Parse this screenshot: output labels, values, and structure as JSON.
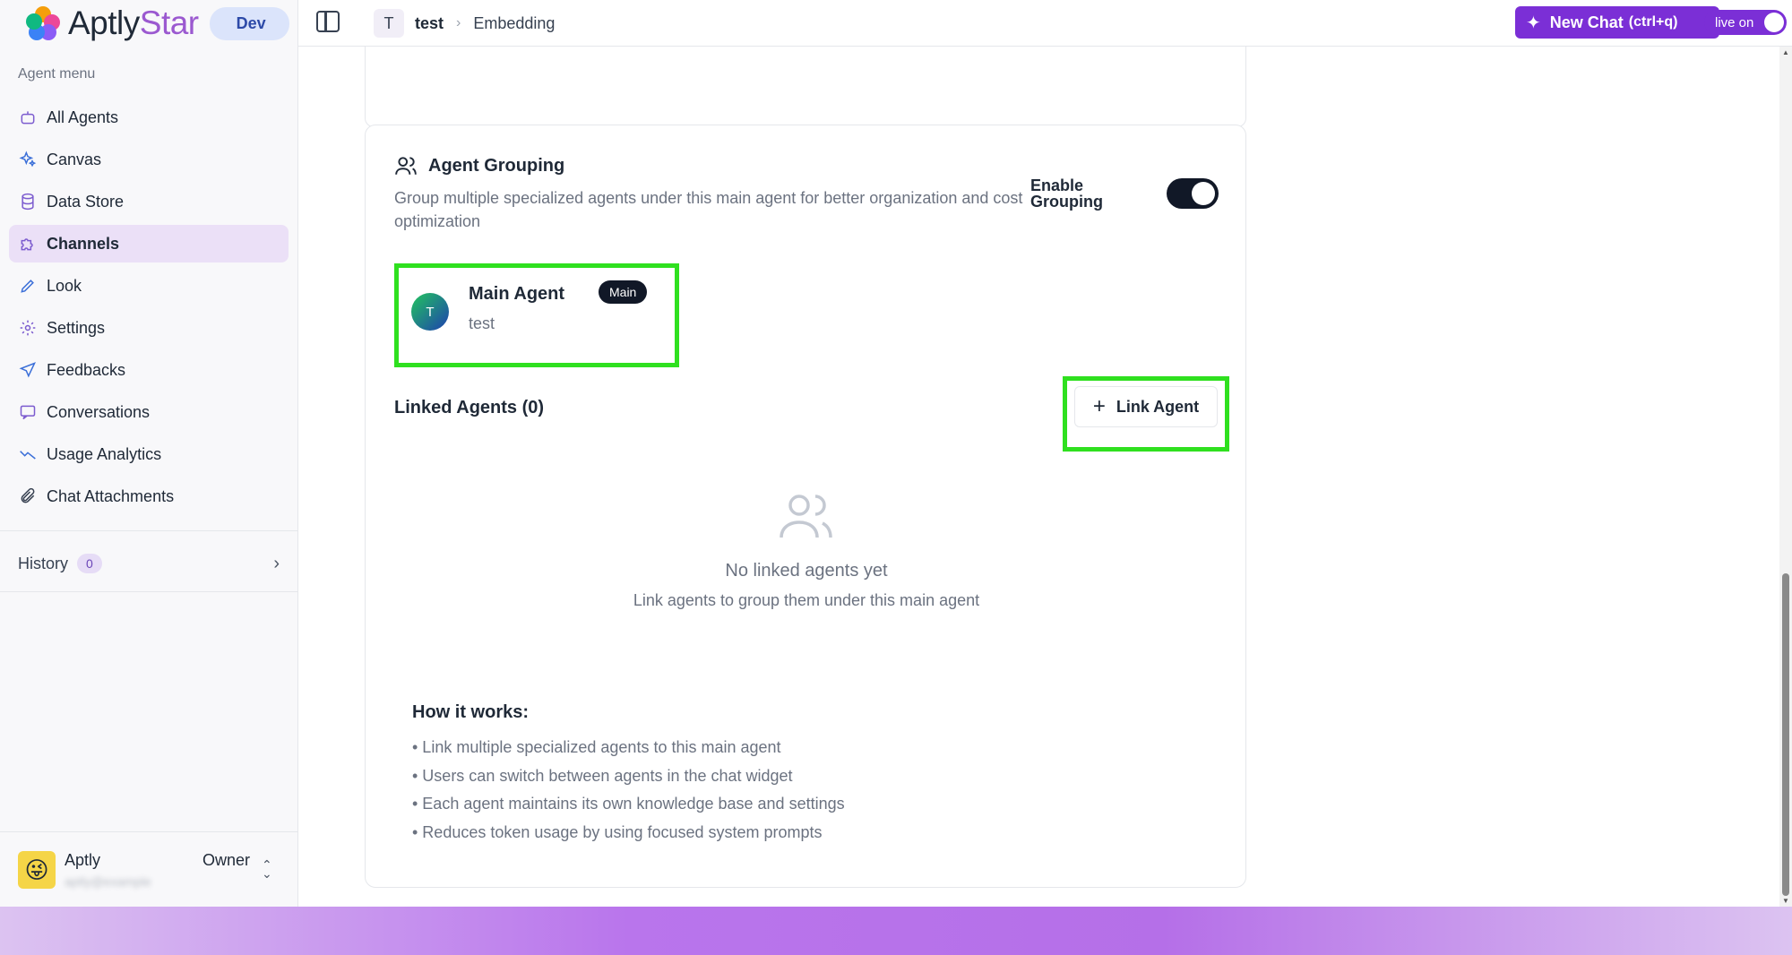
{
  "brand": {
    "name_part1": "Aptly",
    "name_part2": "Star",
    "env_badge": "Dev"
  },
  "sidebar": {
    "heading": "Agent menu",
    "items": [
      {
        "label": "All Agents",
        "icon": "bot-icon",
        "active": false
      },
      {
        "label": "Canvas",
        "icon": "sparkles-icon",
        "active": false
      },
      {
        "label": "Data Store",
        "icon": "database-icon",
        "active": false
      },
      {
        "label": "Channels",
        "icon": "puzzle-icon",
        "active": true
      },
      {
        "label": "Look",
        "icon": "pen-icon",
        "active": false
      },
      {
        "label": "Settings",
        "icon": "gear-icon",
        "active": false
      },
      {
        "label": "Feedbacks",
        "icon": "send-icon",
        "active": false
      },
      {
        "label": "Conversations",
        "icon": "chat-icon",
        "active": false
      },
      {
        "label": "Usage Analytics",
        "icon": "trend-icon",
        "active": false
      },
      {
        "label": "Chat Attachments",
        "icon": "paperclip-icon",
        "active": false
      }
    ],
    "history": {
      "label": "History",
      "count": "0"
    },
    "user": {
      "name": "Aptly",
      "role": "Owner",
      "email": "aptly@example"
    }
  },
  "topbar": {
    "breadcrumb": {
      "avatar_letter": "T",
      "agent": "test",
      "page": "Embedding"
    },
    "new_chat": {
      "label": "New Chat",
      "shortcut": "(ctrl+q)"
    },
    "live_toggle": {
      "label": "live on"
    }
  },
  "grouping": {
    "title": "Agent Grouping",
    "description": "Group multiple specialized agents under this main agent for better organization and cost optimization",
    "enable_label": "Enable Grouping",
    "main_agent": {
      "avatar_letter": "T",
      "name": "Main Agent",
      "badge": "Main",
      "subtitle": "test"
    },
    "linked_title": "Linked Agents (0)",
    "link_button": "Link Agent",
    "empty_title": "No linked agents yet",
    "empty_subtitle": "Link agents to group them under this main agent",
    "how_title": "How it works:",
    "how_items": [
      "• Link multiple specialized agents to this main agent",
      "• Users can switch between agents in the chat widget",
      "• Each agent maintains its own knowledge base and settings",
      "• Reduces token usage by using focused system prompts"
    ]
  },
  "colors": {
    "accent": "#7b2fd6",
    "highlight": "#2fe01f",
    "active_bg": "#ebe0f7"
  }
}
